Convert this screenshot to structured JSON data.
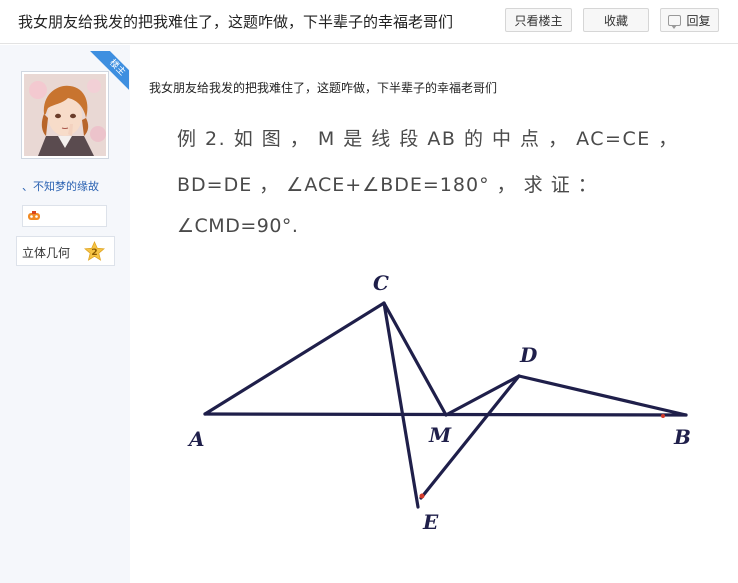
{
  "header": {
    "title": "我女朋友给我发的把我难住了，这题咋做，下半辈子的幸福老哥们",
    "only_op_label": "只看楼主",
    "favorite_label": "收藏",
    "reply_label": "回复"
  },
  "sidebar": {
    "op_badge": "楼主",
    "username": "、不知梦的缘故",
    "level_name": "立体几何",
    "level_number": "2"
  },
  "post": {
    "text": "我女朋友给我发的把我难住了，这题咋做，下半辈子的幸福老哥们",
    "problem_line1": "例 2. 如 图 ， M 是 线 段 AB 的 中 点 ， AC=CE ，",
    "problem_line2": "BD=DE   ，  ∠ACE+∠BDE=180°   ，   求  证  ：",
    "problem_line3": "∠CMD=90°.",
    "points": {
      "A": "A",
      "B": "B",
      "C": "C",
      "D": "D",
      "E": "E",
      "M": "M"
    }
  },
  "colors": {
    "line": "#1f1f4a",
    "link": "#2d64b3",
    "ribbon": "#3e8fe0"
  }
}
